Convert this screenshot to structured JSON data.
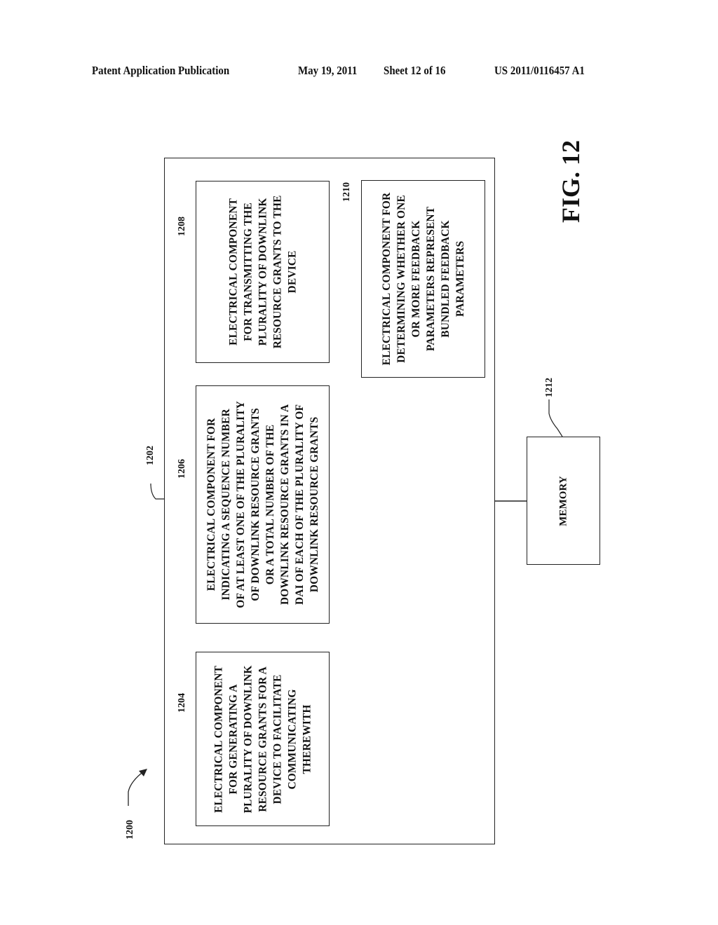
{
  "header": {
    "publication": "Patent Application Publication",
    "date": "May 19, 2011",
    "sheet": "Sheet 12 of 16",
    "number": "US 2011/0116457 A1"
  },
  "figure": {
    "label": "FIG. 12",
    "system_ref": "1200",
    "container_ref": "1202",
    "components": [
      {
        "ref": "1204",
        "text": "ELECTRICAL COMPONENT\nFOR GENERATING A\nPLURALITY OF DOWNLINK\nRESOURCE GRANTS FOR A\nDEVICE TO FACILITATE\nCOMMUNICATING\nTHEREWITH"
      },
      {
        "ref": "1206",
        "text": "ELECTRICAL COMPONENT FOR\nINDICATING A SEQUENCE NUMBER\nOF AT LEAST ONE OF THE PLURALITY\nOF DOWNLINK RESOURCE GRANTS\nOR A TOTAL NUMBER OF THE\nDOWNLINK RESOURCE GRANTS IN A\nDAI OF EACH OF THE PLURALITY OF\nDOWNLINK RESOURCE GRANTS"
      },
      {
        "ref": "1208",
        "text": "ELECTRICAL COMPONENT\nFOR TRANSMITTING THE\nPLURALITY OF DOWNLINK\nRESOURCE GRANTS TO THE\nDEVICE"
      },
      {
        "ref": "1210",
        "text": "ELECTRICAL COMPONENT FOR\nDETERMINING WHETHER ONE\nOR MORE FEEDBACK\nPARAMETERS REPRESENT\nBUNDLED FEEDBACK\nPARAMETERS"
      }
    ],
    "memory": {
      "ref": "1212",
      "text": "MEMORY"
    }
  }
}
